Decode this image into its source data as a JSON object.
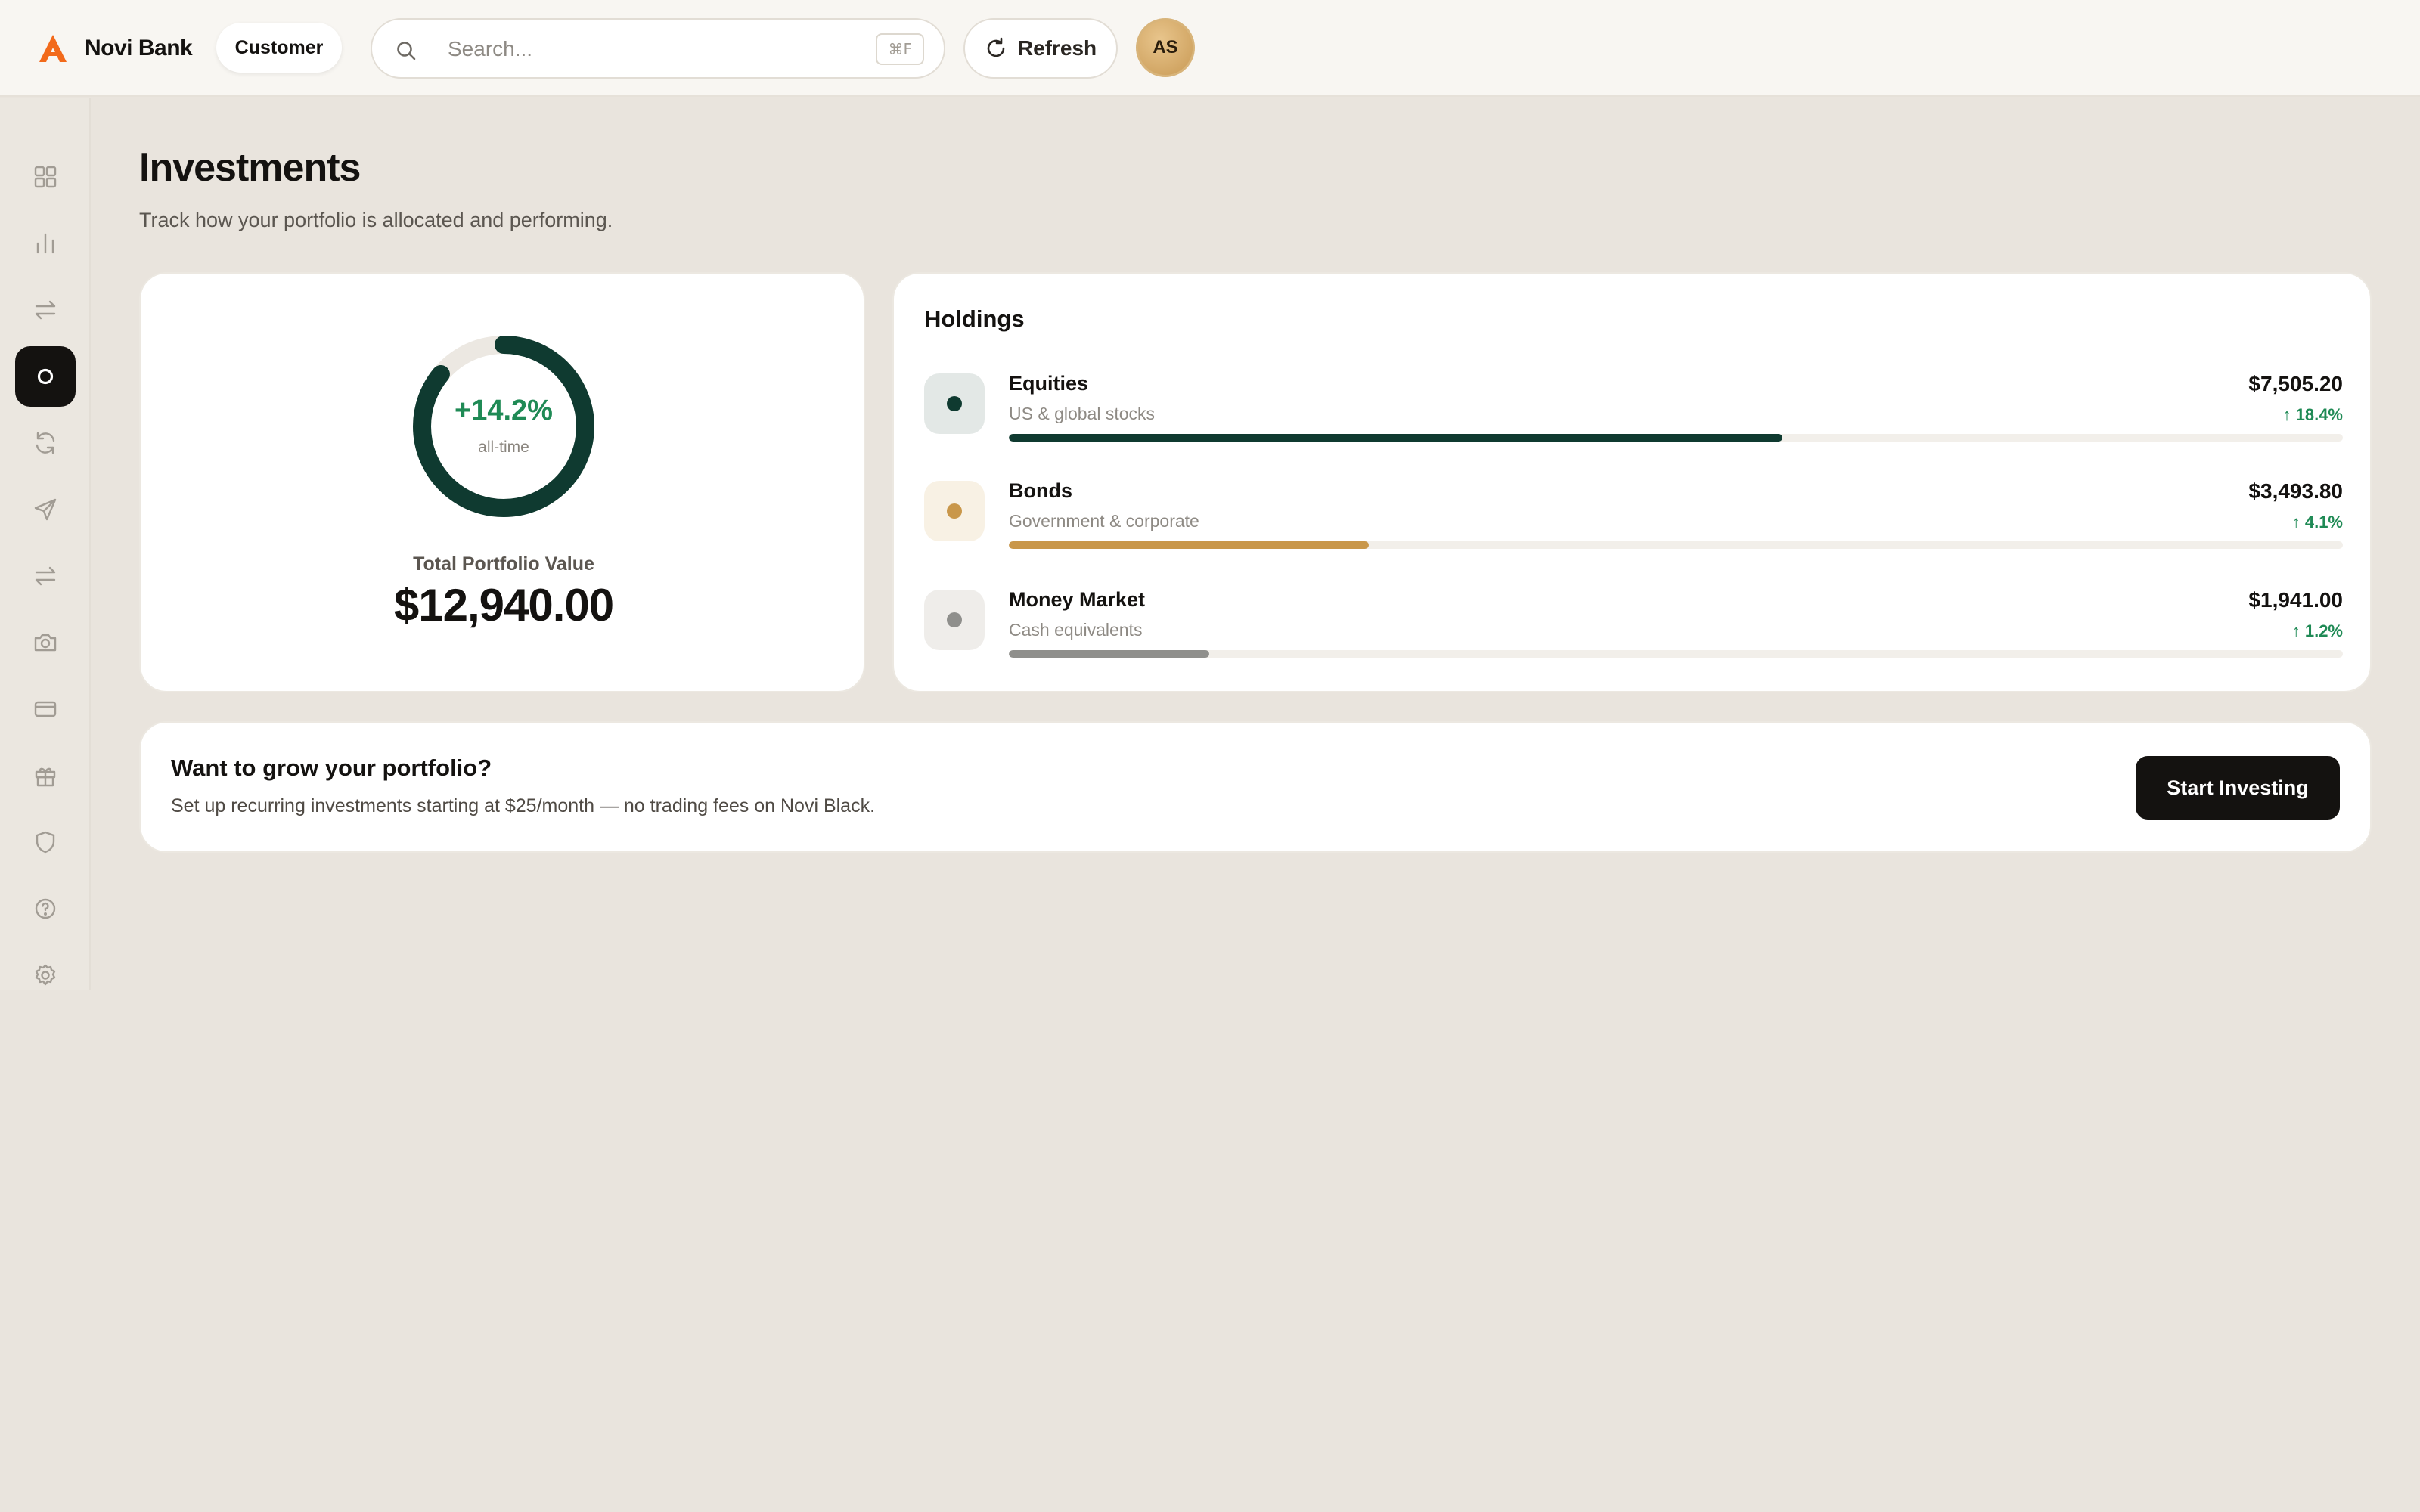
{
  "brand": {
    "name": "Novi Bank",
    "accent": "#f26a1b"
  },
  "header": {
    "role_label": "Customer",
    "search_placeholder": "Search...",
    "search_value": "",
    "search_shortcut": "⌘F",
    "refresh_label": "Refresh",
    "avatar_initials": "AS"
  },
  "sidebar": {
    "items": [
      {
        "icon": "grid-icon",
        "active": false
      },
      {
        "icon": "bar-chart-icon",
        "active": false
      },
      {
        "icon": "transfer-arrows-icon",
        "active": false
      },
      {
        "icon": "investments-circle-icon",
        "active": true
      },
      {
        "icon": "refresh-icon",
        "active": false
      },
      {
        "icon": "send-icon",
        "active": false
      },
      {
        "icon": "swap-icon",
        "active": false
      },
      {
        "icon": "camera-icon",
        "active": false
      },
      {
        "icon": "card-icon",
        "active": false
      },
      {
        "icon": "gift-icon",
        "active": false
      },
      {
        "icon": "shield-icon",
        "active": false
      },
      {
        "icon": "help-icon",
        "active": false
      },
      {
        "icon": "gear-icon",
        "active": false
      }
    ]
  },
  "page": {
    "title": "Investments",
    "subtitle": "Track how your portfolio is allocated and performing."
  },
  "summary": {
    "performance": "+14.2%",
    "performance_period": "all-time",
    "performance_fraction": 0.142,
    "total_label": "Total Portfolio Value",
    "total_value": "$12,940.00"
  },
  "holdings": {
    "title": "Holdings",
    "items": [
      {
        "name": "Equities",
        "description": "US & global stocks",
        "amount": "$7,505.20",
        "change": "↑ 18.4%",
        "allocation_fraction": 0.58,
        "color": "#0f3a30",
        "icon_bg": "#e3e8e6"
      },
      {
        "name": "Bonds",
        "description": "Government & corporate",
        "amount": "$3,493.80",
        "change": "↑ 4.1%",
        "allocation_fraction": 0.27,
        "color": "#c9974a",
        "icon_bg": "#f8f1e4"
      },
      {
        "name": "Money Market",
        "description": "Cash equivalents",
        "amount": "$1,941.00",
        "change": "↑ 1.2%",
        "allocation_fraction": 0.15,
        "color": "#8f8f8c",
        "icon_bg": "#efedea"
      }
    ]
  },
  "cta": {
    "title": "Want to grow your portfolio?",
    "text": "Set up recurring investments starting at $25/month — no trading fees on Novi Black.",
    "button_label": "Start Investing"
  },
  "colors": {
    "positive": "#1f8a55",
    "donut_fill": "#0f3a30",
    "donut_track": "#ece8e2",
    "dark": "#141210"
  }
}
